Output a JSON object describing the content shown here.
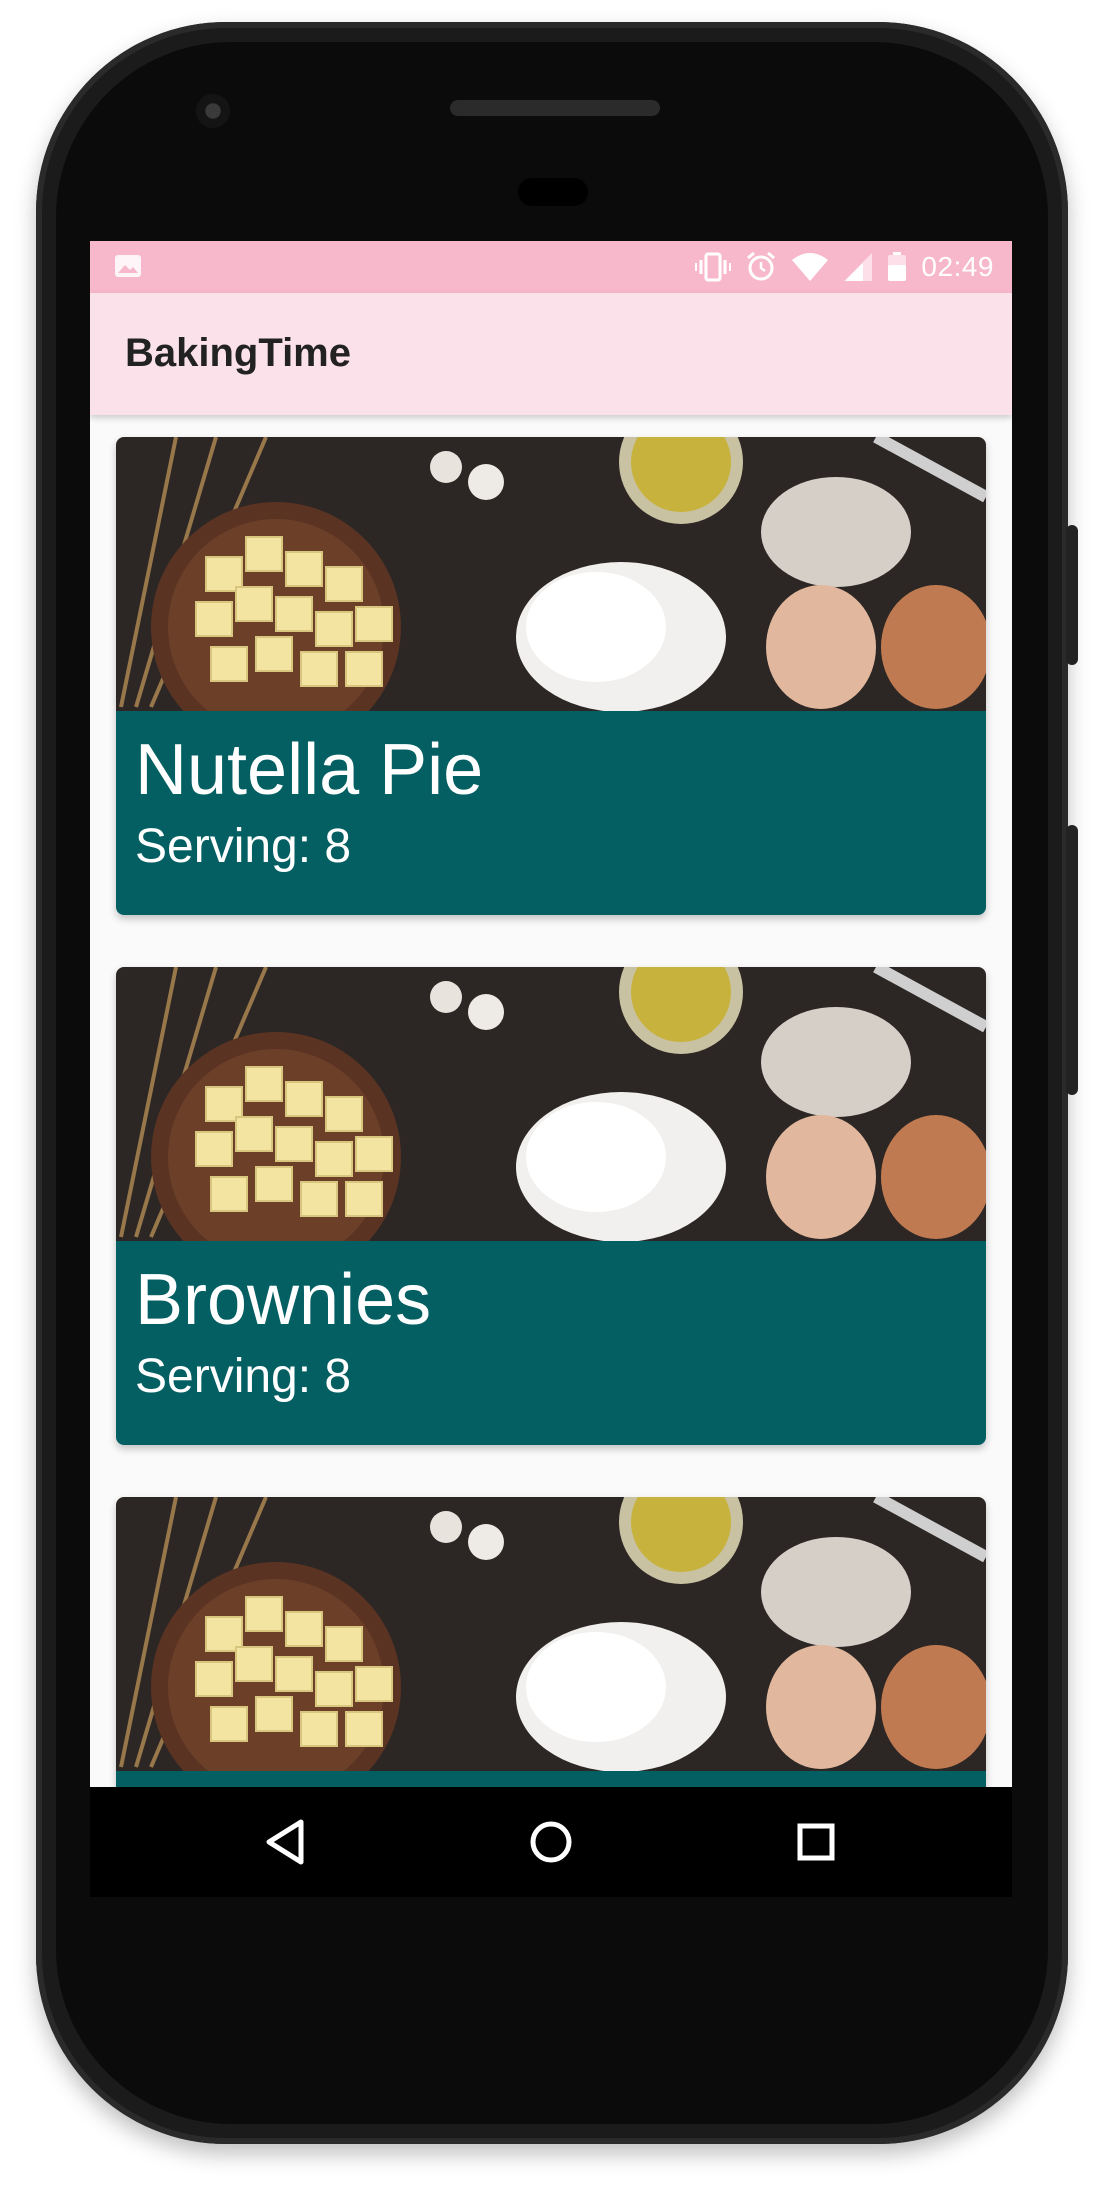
{
  "status_bar": {
    "time": "02:49",
    "icons": [
      "image-notification-icon",
      "vibrate-icon",
      "alarm-icon",
      "wifi-icon",
      "cell-signal-icon",
      "battery-icon"
    ]
  },
  "app_bar": {
    "title": "BakingTime"
  },
  "recipes": [
    {
      "name": "Nutella Pie",
      "serving": "Serving: 8"
    },
    {
      "name": "Brownies",
      "serving": "Serving: 8"
    },
    {
      "name": "",
      "serving": ""
    }
  ],
  "nav_bar": {
    "icons": [
      "back-icon",
      "home-icon",
      "recents-icon"
    ]
  },
  "colors": {
    "status_bar": "#f8b8cc",
    "app_bar": "#fbe1ea",
    "card_footer": "#045f62"
  }
}
